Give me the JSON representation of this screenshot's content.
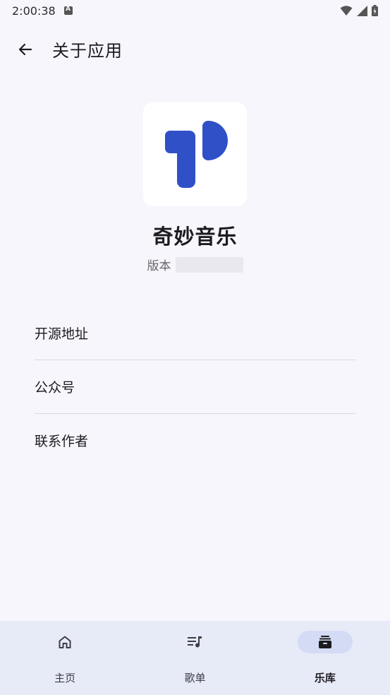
{
  "status_bar": {
    "time": "2:00:38",
    "icons": [
      "notification-a-icon",
      "wifi-icon",
      "signal-icon",
      "battery-icon"
    ]
  },
  "top_bar": {
    "back_icon": "arrow-left-icon",
    "title": "关于应用"
  },
  "app_info": {
    "logo_icon": "app-logo-icon",
    "logo_color": "#3050c8",
    "name": "奇妙音乐",
    "version_label": "版本",
    "version_value": ""
  },
  "menu": {
    "items": [
      {
        "label": "开源地址"
      },
      {
        "label": "公众号"
      },
      {
        "label": "联系作者"
      }
    ]
  },
  "bottom_nav": {
    "items": [
      {
        "label": "主页",
        "icon": "home-icon",
        "active": false
      },
      {
        "label": "歌单",
        "icon": "playlist-icon",
        "active": false
      },
      {
        "label": "乐库",
        "icon": "library-icon",
        "active": true
      }
    ]
  },
  "colors": {
    "background": "#f7f6fd",
    "nav_background": "#e7eaf7",
    "nav_active_pill": "#d3dbf5"
  }
}
